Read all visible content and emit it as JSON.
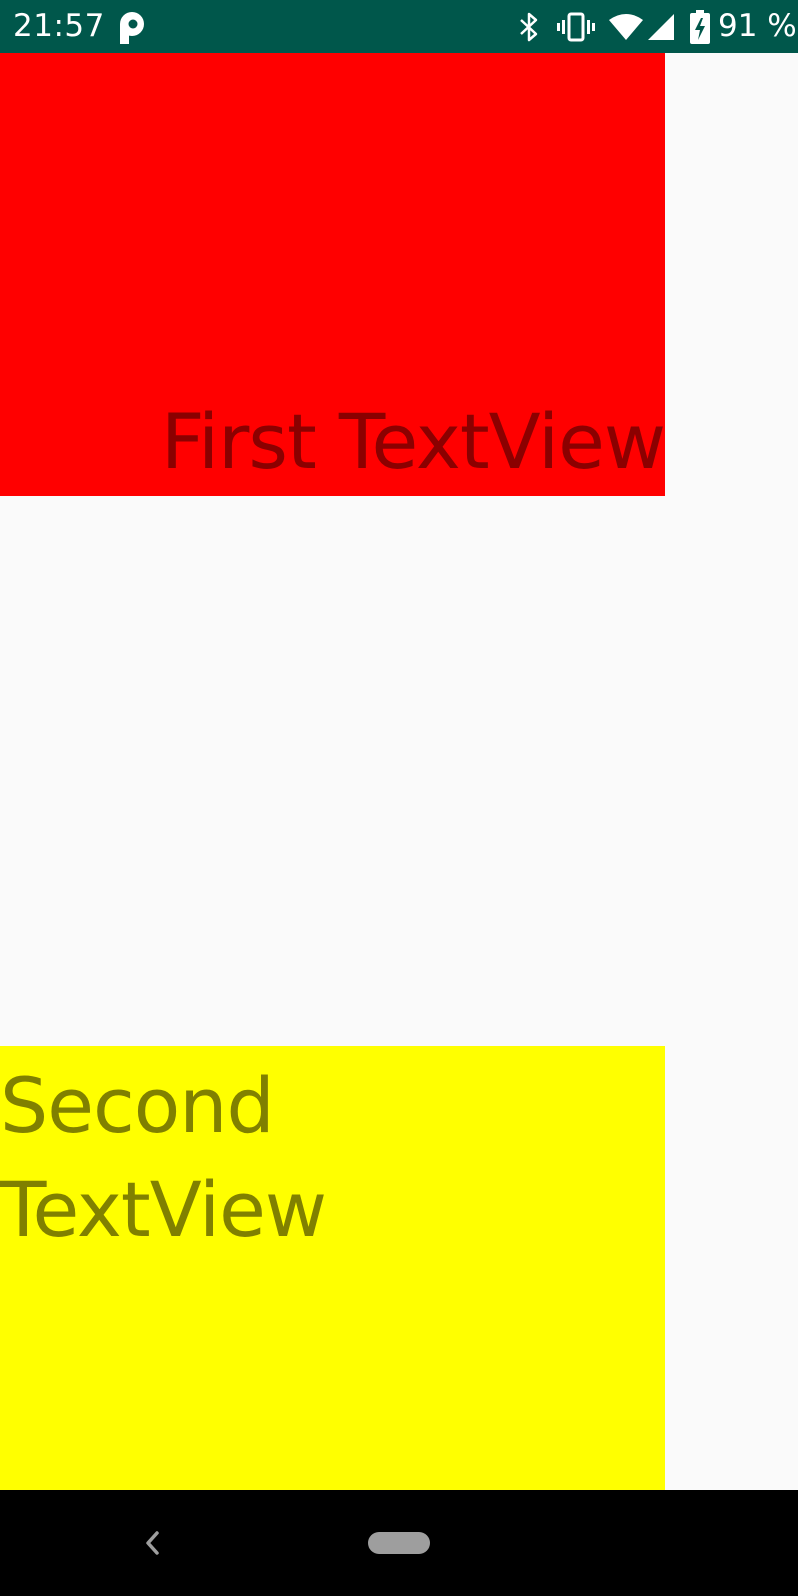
{
  "status_bar": {
    "time": "21:57",
    "battery_percent": "91 %",
    "background_color": "#00574b",
    "icons": [
      "parking-icon",
      "bluetooth-icon",
      "vibrate-icon",
      "wifi-icon",
      "cell-signal-icon",
      "battery-charging-icon"
    ]
  },
  "main": {
    "first_textview": {
      "text": "First TextView",
      "background_color": "#ff0000",
      "text_color": "#8b0000"
    },
    "second_textview": {
      "text": "Second TextView",
      "background_color": "#ffff00",
      "text_color": "#808000"
    }
  },
  "nav_bar": {
    "icons": [
      "back-icon",
      "home-pill-icon"
    ]
  }
}
